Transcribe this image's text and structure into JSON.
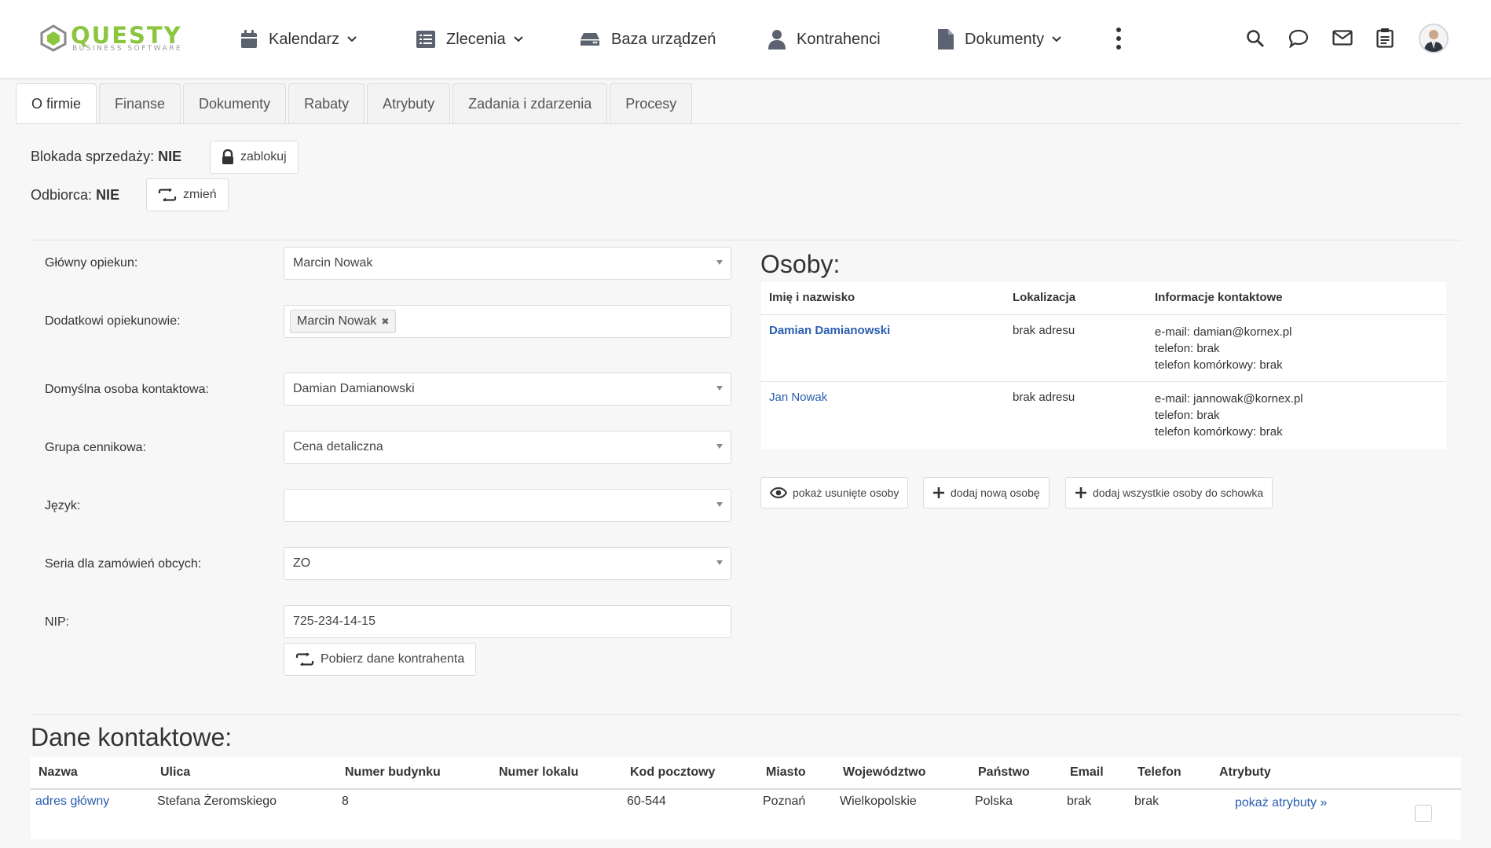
{
  "brand": {
    "name": "QUESTY",
    "tagline": "BUSINESS SOFTWARE",
    "color": "#8cc63f"
  },
  "nav": {
    "items": [
      {
        "label": "Kalendarz",
        "icon": "calendar-icon",
        "has_dropdown": true
      },
      {
        "label": "Zlecenia",
        "icon": "list-icon",
        "has_dropdown": true
      },
      {
        "label": "Baza urządzeń",
        "icon": "device-icon",
        "has_dropdown": false
      },
      {
        "label": "Kontrahenci",
        "icon": "person-icon",
        "has_dropdown": false
      },
      {
        "label": "Dokumenty",
        "icon": "document-icon",
        "has_dropdown": true
      }
    ],
    "right_icons": [
      "more-icon",
      "search-icon",
      "chat-icon",
      "mail-icon",
      "clipboard-icon",
      "avatar"
    ]
  },
  "tabs": [
    "O firmie",
    "Finanse",
    "Dokumenty",
    "Rabaty",
    "Atrybuty",
    "Zadania i zdarzenia",
    "Procesy"
  ],
  "active_tab": "O firmie",
  "status": {
    "blokada_label": "Blokada sprzedaży:",
    "blokada_value": "NIE",
    "blokada_button": "zablokuj",
    "odbiorca_label": "Odbiorca:",
    "odbiorca_value": "NIE",
    "odbiorca_button": "zmień"
  },
  "form": {
    "glowny_label": "Główny opiekun:",
    "glowny_value": "Marcin Nowak",
    "dodatkowi_label": "Dodatkowi opiekunowie:",
    "dodatkowi_tag": "Marcin Nowak",
    "domyslna_label": "Domyślna osoba kontaktowa:",
    "domyslna_value": "Damian Damianowski",
    "grupa_label": "Grupa cennikowa:",
    "grupa_value": "Cena detaliczna",
    "jezyk_label": "Język:",
    "jezyk_value": "",
    "seria_label": "Seria dla zamówień obcych:",
    "seria_value": "ZO",
    "nip_label": "NIP:",
    "nip_value": "725-234-14-15",
    "pobierz_button": "Pobierz dane kontrahenta"
  },
  "osoby": {
    "title": "Osoby:",
    "headers": [
      "Imię i nazwisko",
      "Lokalizacja",
      "Informacje kontaktowe"
    ],
    "rows": [
      {
        "name": "Damian Damianowski",
        "location": "brak adresu",
        "email": "e-mail: damian@kornex.pl",
        "phone": "telefon: brak",
        "mobile": "telefon komórkowy: brak"
      },
      {
        "name": "Jan Nowak",
        "location": "brak adresu",
        "email": "e-mail: jannowak@kornex.pl",
        "phone": "telefon: brak",
        "mobile": "telefon komórkowy: brak"
      }
    ],
    "buttons": {
      "show_deleted": "pokaż usunięte osoby",
      "add_new": "dodaj nową osobę",
      "add_all": "dodaj wszystkie osoby do schowka"
    }
  },
  "dane_kontaktowe": {
    "title": "Dane kontaktowe:",
    "headers": [
      "Nazwa",
      "Ulica",
      "Numer budynku",
      "Numer lokalu",
      "Kod pocztowy",
      "Miasto",
      "Województwo",
      "Państwo",
      "Email",
      "Telefon",
      "Atrybuty"
    ],
    "row": {
      "nazwa": "adres główny",
      "ulica": "Stefana Żeromskiego",
      "numer_budynku": "8",
      "numer_lokalu": "",
      "kod": "60-544",
      "miasto": "Poznań",
      "wojewodztwo": "Wielkopolskie",
      "panstwo": "Polska",
      "email": "brak",
      "telefon": "brak",
      "atrybuty": "pokaż atrybuty »"
    }
  }
}
